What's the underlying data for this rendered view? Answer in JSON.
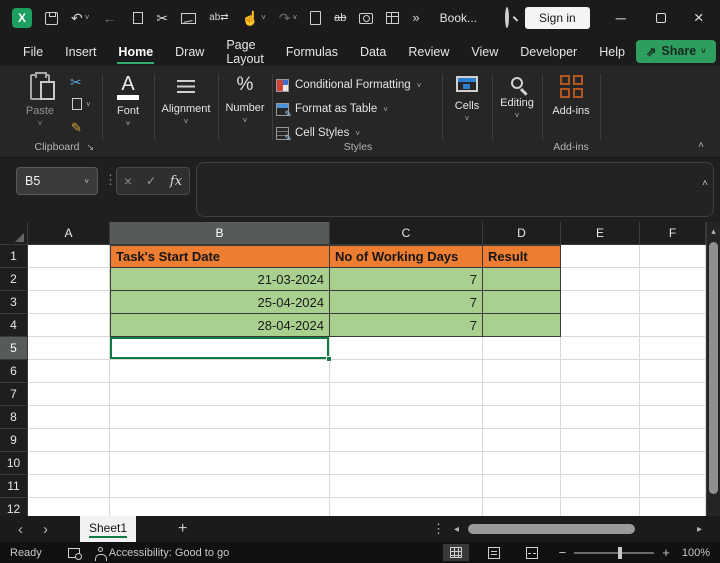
{
  "colors": {
    "accent_green": "#2E9E5E",
    "selection_green": "#107C41",
    "header_orange": "#ED7D31",
    "row_green": "#A9D08E"
  },
  "titlebar": {
    "title": "Book...",
    "sign_in_label": "Sign in",
    "icons": {
      "undo": "↶",
      "redo": "↷",
      "back": "←",
      "cut": "✂",
      "replace": "ab⇄",
      "touch": "☝",
      "strikethrough": "ab",
      "overflow": "»",
      "minimize": "─",
      "close": "×",
      "chevron_down": "˅"
    }
  },
  "menu": {
    "tabs": [
      "File",
      "Insert",
      "Home",
      "Draw",
      "Page Layout",
      "Formulas",
      "Data",
      "Review",
      "View",
      "Developer",
      "Help"
    ],
    "active_tab": "Home",
    "share_label": "Share",
    "share_icon": "⇗"
  },
  "ribbon": {
    "paste_label": "Paste",
    "clipboard_group_label": "Clipboard",
    "font_label": "Font",
    "font_icon_letter": "A",
    "alignment_label": "Alignment",
    "number_label": "Number",
    "number_icon": "%",
    "conditional_formatting_label": "Conditional Formatting",
    "format_as_table_label": "Format as Table",
    "cell_styles_label": "Cell Styles",
    "styles_group_label": "Styles",
    "cells_label": "Cells",
    "editing_label": "Editing",
    "addins_label": "Add-ins",
    "addins_group_label": "Add-ins",
    "chevron_down": "˅",
    "chevron_up": "˄",
    "launcher_icon": "↘",
    "cut_icon": "✂",
    "format_painter_icon": "✎"
  },
  "formula_bar": {
    "name_box_value": "B5",
    "cancel_icon": "×",
    "enter_icon": "✓",
    "fx_label": "fx",
    "formula_value": "",
    "chevron_down": "˅",
    "expand_icon": "˄"
  },
  "grid": {
    "col_headers": [
      "A",
      "B",
      "C",
      "D",
      "E",
      "F"
    ],
    "row_headers": [
      "1",
      "2",
      "3",
      "4",
      "5",
      "6",
      "7",
      "8",
      "9",
      "10",
      "11",
      "12"
    ],
    "selected_cell": "B5",
    "table": {
      "header_row": {
        "b": "Task's Start Date",
        "c": "No of Working Days",
        "d": "Result"
      },
      "rows": [
        {
          "b": "21-03-2024",
          "c": "7",
          "d": ""
        },
        {
          "b": "25-04-2024",
          "c": "7",
          "d": ""
        },
        {
          "b": "28-04-2024",
          "c": "7",
          "d": ""
        }
      ]
    },
    "vscroll_up_icon": "▴"
  },
  "sheet_bar": {
    "prev_icon": "‹",
    "next_icon": "›",
    "sheet_tabs": [
      "Sheet1"
    ],
    "active_sheet": "Sheet1",
    "add_sheet_icon": "+",
    "more_icon": "⋮",
    "hscroll_left_icon": "◂",
    "hscroll_right_icon": "▸"
  },
  "status_bar": {
    "mode": "Ready",
    "accessibility": "Accessibility: Good to go",
    "zoom_out_icon": "−",
    "zoom_in_icon": "+",
    "zoom_level": "100%"
  }
}
